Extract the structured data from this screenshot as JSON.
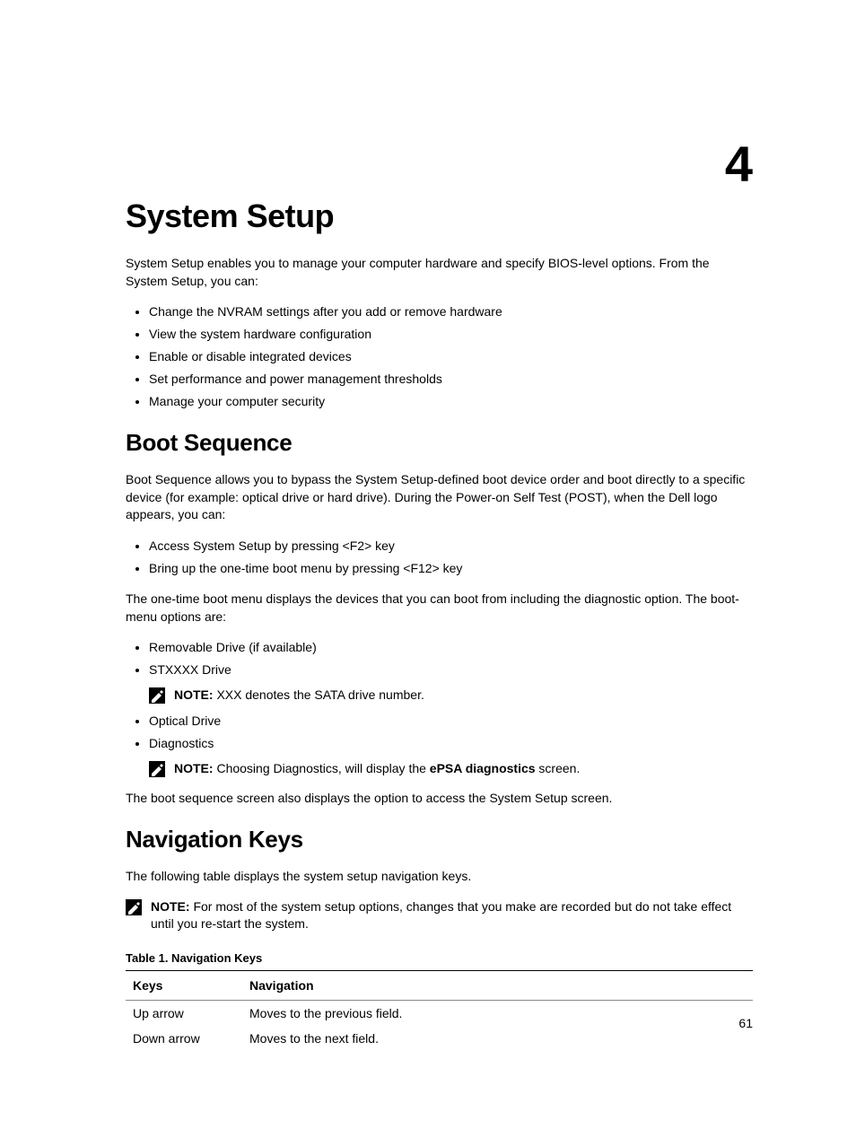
{
  "chapter_number": "4",
  "title": "System Setup",
  "intro": "System Setup enables you to manage your computer hardware and specify BIOS-level options. From the System Setup, you can:",
  "intro_bullets": [
    "Change the NVRAM settings after you add or remove hardware",
    "View the system hardware configuration",
    "Enable or disable integrated devices",
    "Set performance and power management thresholds",
    "Manage your computer security"
  ],
  "boot": {
    "heading": "Boot Sequence",
    "para1": "Boot Sequence allows you to bypass the System Setup‐defined boot device order and boot directly to a specific device (for example: optical drive or hard drive). During the Power-on Self Test (POST), when the Dell logo appears, you can:",
    "bullets1": [
      "Access System Setup by pressing <F2> key",
      "Bring up the one-time boot menu by pressing <F12> key"
    ],
    "para2": "The one-time boot menu displays the devices that you can boot from including the diagnostic option. The boot-menu options are:",
    "bullets2": {
      "item1": "Removable Drive (if available)",
      "item2": "STXXXX Drive",
      "note1_label": "NOTE:",
      "note1_text": " XXX denotes the SATA drive number.",
      "item3": "Optical Drive",
      "item4": "Diagnostics",
      "note2_label": "NOTE:",
      "note2_text_a": " Choosing Diagnostics, will display the ",
      "note2_bold": "ePSA diagnostics",
      "note2_text_b": " screen."
    },
    "para3": "The boot sequence screen also displays the option to access the System Setup screen."
  },
  "nav": {
    "heading": "Navigation Keys",
    "para1": "The following table displays the system setup navigation keys.",
    "note_label": "NOTE:",
    "note_text": " For most of the system setup options, changes that you make are recorded but do not take effect until you re-start the system.",
    "table_caption": "Table 1. Navigation Keys",
    "table": {
      "headers": [
        "Keys",
        "Navigation"
      ],
      "rows": [
        [
          "Up arrow",
          "Moves to the previous field."
        ],
        [
          "Down arrow",
          "Moves to the next field."
        ]
      ]
    }
  },
  "page_number": "61"
}
